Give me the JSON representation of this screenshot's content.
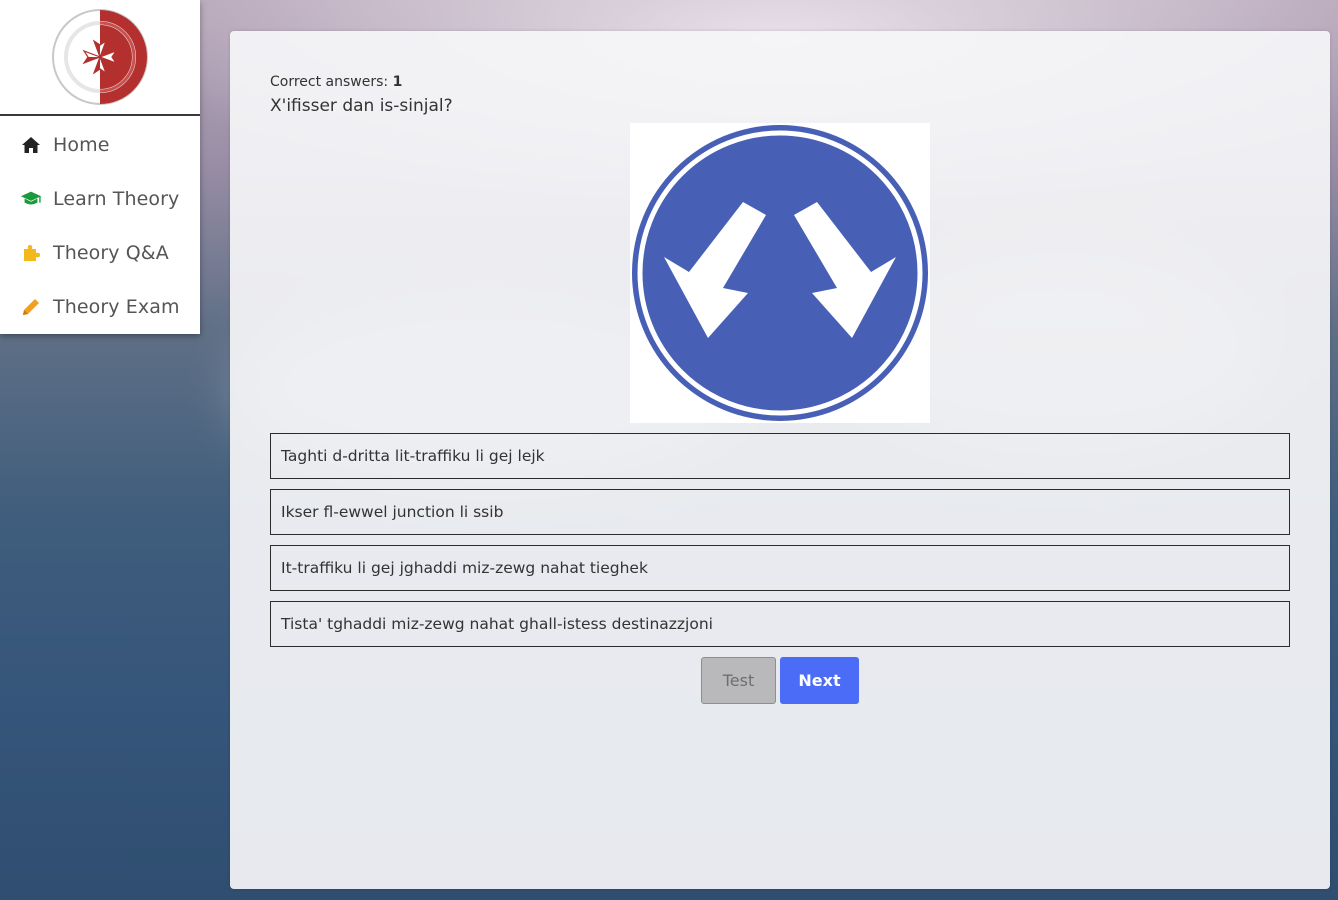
{
  "sidebar": {
    "logo": "malta-cross-steering-wheel-logo",
    "items": [
      {
        "label": "Home",
        "icon": "home-icon",
        "color": "#222222"
      },
      {
        "label": "Learn Theory",
        "icon": "graduation-cap-icon",
        "color": "#1a9a3a"
      },
      {
        "label": "Theory Q&A",
        "icon": "puzzle-icon",
        "color": "#f2b81c"
      },
      {
        "label": "Theory Exam",
        "icon": "pencil-icon",
        "color": "#f0a020"
      }
    ]
  },
  "quiz": {
    "correct_label": "Correct answers:",
    "correct_count": "1",
    "question": "X'ifisser dan is-sinjal?",
    "sign": "pass-either-side-sign",
    "answers": [
      "Taghti d-dritta lit-traffiku li gej lejk",
      "Ikser fl-ewwel junction li ssib",
      "It-traffiku li gej jghaddi miz-zewg nahat tieghek",
      "Tista' tghaddi miz-zewg nahat ghall-istess destinazzjoni"
    ],
    "test_button": "Test",
    "next_button": "Next"
  },
  "colors": {
    "sign_blue": "#4760b5",
    "next_button": "#4a6cf7",
    "logo_red": "#b3302e"
  }
}
